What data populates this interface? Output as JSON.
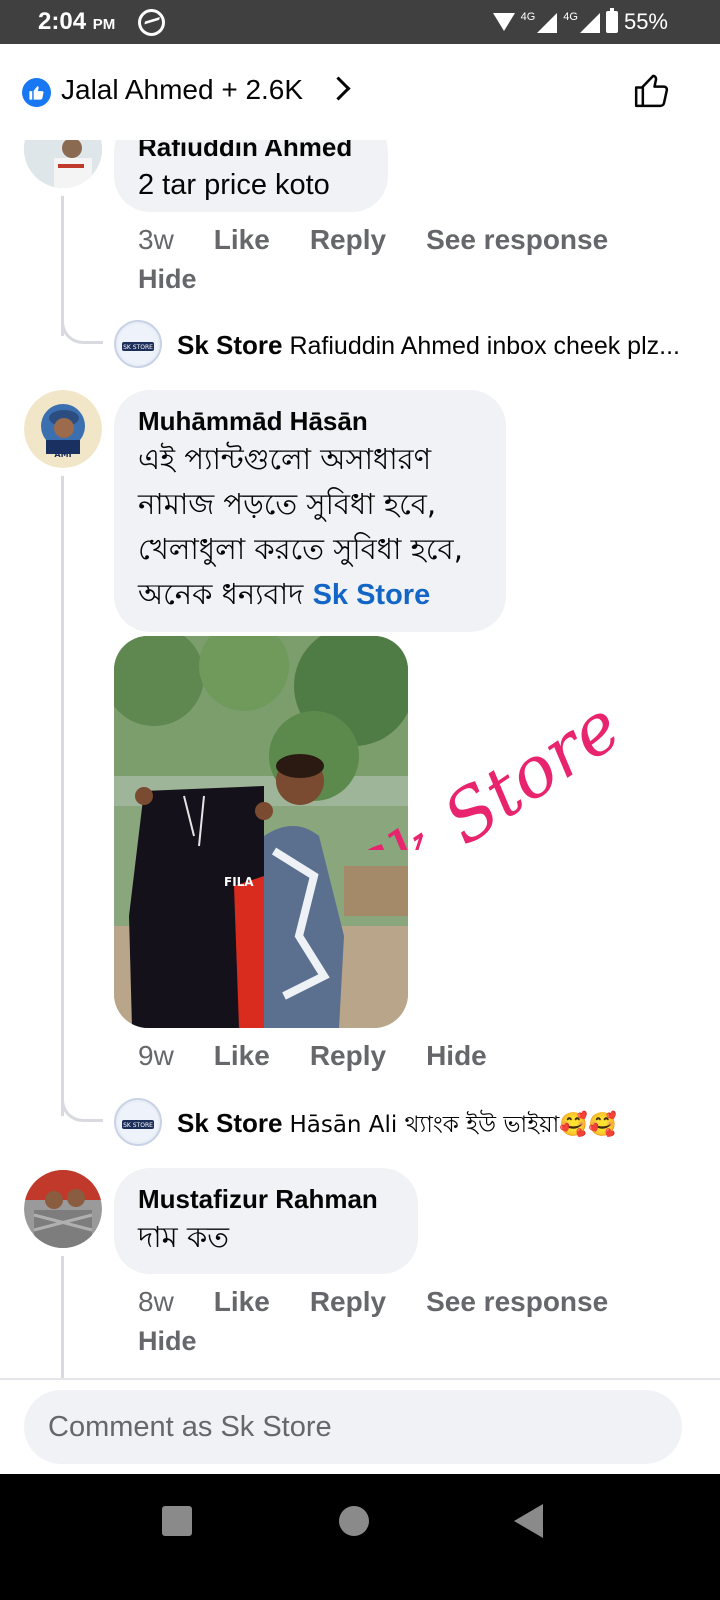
{
  "status_bar": {
    "time": "2:04",
    "ampm": "PM",
    "network1": "4G",
    "network2": "4G",
    "battery": "55%",
    "icons": [
      "messenger-icon",
      "wifi-icon",
      "signal-icon",
      "battery-icon"
    ]
  },
  "header": {
    "reactors": "Jalal Ahmed + 2.6K",
    "icons": [
      "like-badge-icon",
      "chevron-right-icon",
      "thumbs-up-icon"
    ]
  },
  "comments": [
    {
      "name": "Rafiuddin Ahmed",
      "text": "2 tar price koto",
      "time": "3w",
      "actions": [
        "Like",
        "Reply",
        "See response"
      ],
      "hide": "Hide",
      "reply": {
        "name": "Sk Store",
        "text": "Rafiuddin Ahmed inbox cheek plz..."
      }
    },
    {
      "name": "Muhāmmād Hāsān",
      "text_lines": [
        "এই প্যান্টগুলো অসাধারণ",
        "নামাজ পড়তে সুবিধা হবে,",
        "খেলাধুলা করতে সুবিধা হবে,",
        "অনেক ধন্যবাদ"
      ],
      "tag": "Sk Store",
      "time": "9w",
      "actions": [
        "Like",
        "Reply",
        "Hide"
      ],
      "photo_watermark": "Sk Store",
      "photo_brand": "FILA",
      "reply": {
        "name": "Sk Store",
        "text": "Hāsān Ali থ্যাংক ইউ ভাইয়া🥰🥰"
      }
    },
    {
      "name": "Mustafizur Rahman",
      "text": "দাম কত",
      "time": "8w",
      "actions": [
        "Like",
        "Reply",
        "See response"
      ],
      "hide": "Hide"
    }
  ],
  "avatar_labels": {
    "sk_store": "SK STORE",
    "hasan": "AMI"
  },
  "composer": {
    "placeholder": "Comment as Sk Store"
  },
  "nav_bar": {
    "icons": [
      "recents-icon",
      "home-icon",
      "back-icon"
    ]
  },
  "colors": {
    "accent": "#1877f2",
    "tag": "#1366c5",
    "watermark": "#e8246e",
    "muted": "#65676b",
    "bubble": "#f0f2f5"
  }
}
